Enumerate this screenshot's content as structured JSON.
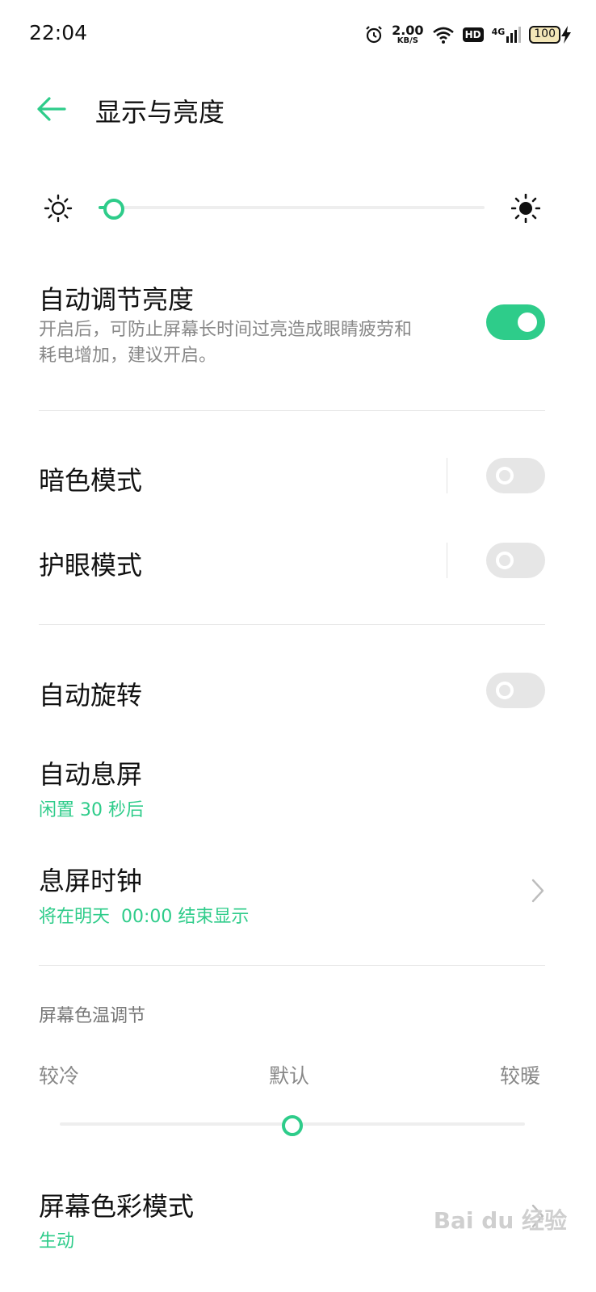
{
  "status_bar": {
    "time": "22:04",
    "net_speed_value": "2.00",
    "net_speed_unit": "KB/S",
    "hd_label": "HD",
    "network_label": "4G",
    "battery": "100"
  },
  "header": {
    "title": "显示与亮度"
  },
  "brightness": {
    "level": 0.04
  },
  "auto_brightness": {
    "title": "自动调节亮度",
    "desc_line1": "开启后，可防止屏幕长时间过亮造成眼睛疲劳和",
    "desc_line2": "耗电增加，建议开启。",
    "enabled": true
  },
  "dark_mode": {
    "title": "暗色模式",
    "enabled": false
  },
  "eye_care": {
    "title": "护眼模式",
    "enabled": false
  },
  "auto_rotate": {
    "title": "自动旋转",
    "enabled": false
  },
  "screen_timeout": {
    "title": "自动息屏",
    "value": "闲置 30 秒后"
  },
  "aod_clock": {
    "title": "息屏时钟",
    "value": "将在明天  00:00 结束显示"
  },
  "color_temp": {
    "header": "屏幕色温调节",
    "cool": "较冷",
    "default": "默认",
    "warm": "较暖",
    "level": 0.5
  },
  "color_mode": {
    "title": "屏幕色彩模式",
    "value": "生动"
  },
  "watermark": "Bai du 经验",
  "colors": {
    "accent": "#2ecc8a"
  }
}
